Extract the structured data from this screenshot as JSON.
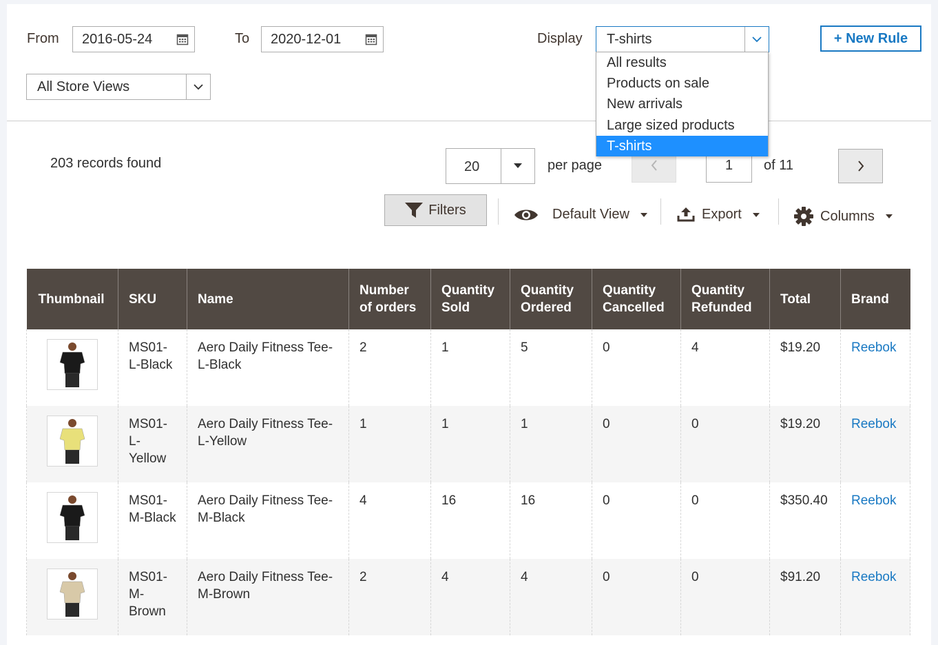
{
  "filters": {
    "from_label": "From",
    "from_value": "2016-05-24",
    "to_label": "To",
    "to_value": "2020-12-01",
    "display_label": "Display",
    "display_value": "T-shirts",
    "display_options": [
      "All results",
      "Products on sale",
      "New arrivals",
      "Large sized products",
      "T-shirts"
    ],
    "store_view_value": "All Store Views",
    "new_rule_label": "+ New Rule"
  },
  "toolbar": {
    "records_found": "203 records found",
    "per_page_value": "20",
    "per_page_label": "per page",
    "current_page": "1",
    "of_pages": "of 11",
    "filters_label": "Filters",
    "default_view_label": "Default View",
    "export_label": "Export",
    "columns_label": "Columns"
  },
  "table": {
    "headers": [
      "Thumbnail",
      "SKU",
      "Name",
      "Number of orders",
      "Quantity Sold",
      "Quantity Ordered",
      "Quantity Cancelled",
      "Quantity Refunded",
      "Total",
      "Brand"
    ],
    "rows": [
      {
        "sku": "MS01-L-Black",
        "name": "Aero Daily Fitness Tee-L-Black",
        "orders": "2",
        "sold": "1",
        "ordered": "5",
        "cancelled": "0",
        "refunded": "4",
        "total": "$19.20",
        "brand": "Reebok",
        "shirt_color": "#1a1a1a"
      },
      {
        "sku": "MS01-L-Yellow",
        "name": "Aero Daily Fitness Tee-L-Yellow",
        "orders": "1",
        "sold": "1",
        "ordered": "1",
        "cancelled": "0",
        "refunded": "0",
        "total": "$19.20",
        "brand": "Reebok",
        "shirt_color": "#e8e07a"
      },
      {
        "sku": "MS01-M-Black",
        "name": "Aero Daily Fitness Tee-M-Black",
        "orders": "4",
        "sold": "16",
        "ordered": "16",
        "cancelled": "0",
        "refunded": "0",
        "total": "$350.40",
        "brand": "Reebok",
        "shirt_color": "#1a1a1a"
      },
      {
        "sku": "MS01-M-Brown",
        "name": "Aero Daily Fitness Tee-M-Brown",
        "orders": "2",
        "sold": "4",
        "ordered": "4",
        "cancelled": "0",
        "refunded": "0",
        "total": "$91.20",
        "brand": "Reebok",
        "shirt_color": "#d8c9a8"
      }
    ]
  },
  "colors": {
    "accent": "#1979c3",
    "header_bg": "#514943",
    "selected_option": "#1e90ff"
  }
}
